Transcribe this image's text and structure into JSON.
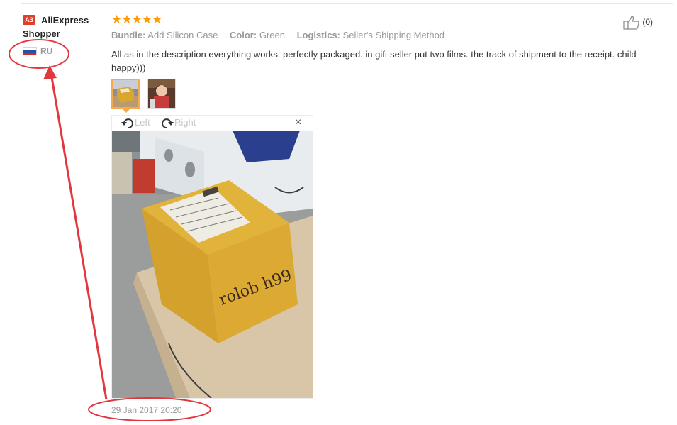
{
  "user": {
    "badge": "A3",
    "name": "AliExpress Shopper",
    "country": "RU",
    "flag_colors": [
      "#ffffff",
      "#2950a8",
      "#d52b1e"
    ]
  },
  "review": {
    "stars": "★★★★★",
    "rating": 5,
    "star_color": "#ff9a00",
    "attributes": [
      {
        "key": "Bundle:",
        "value": "Add Silicon Case"
      },
      {
        "key": "Color:",
        "value": "Green"
      },
      {
        "key": "Logistics:",
        "value": "Seller's Shipping Method"
      }
    ],
    "helpful_icon": "thumbs-up-icon",
    "helpful_count": "(0)",
    "text": "All as in the description everything works. perfectly packaged. in gift seller put two films. the track of shipment to the receipt. child happy)))",
    "date": "29 Jan 2017 20:20"
  },
  "viewer": {
    "rotate_left": "Left",
    "rotate_right": "Right",
    "close": "×",
    "photo_caption": "rolob h99"
  },
  "annotation": {
    "color": "#e2373f"
  }
}
